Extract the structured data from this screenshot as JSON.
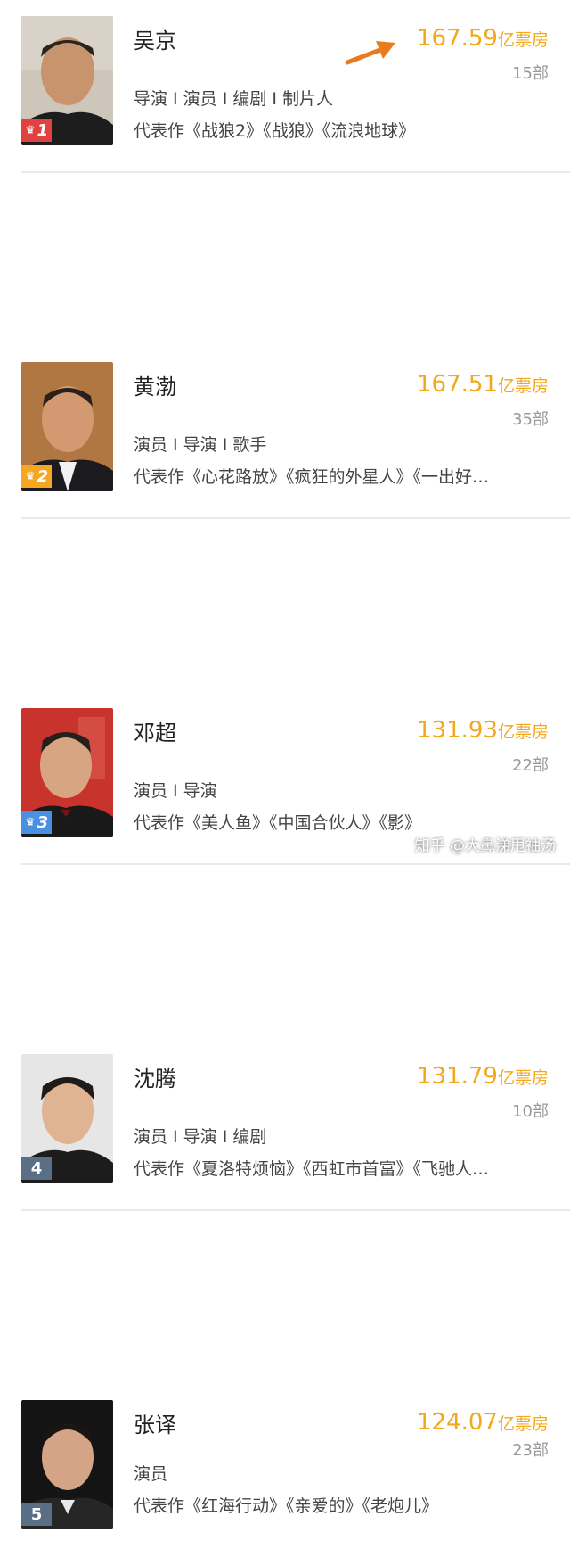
{
  "list": [
    {
      "name": "吴京",
      "roles": "导演 I 演员 I 编剧 I 制片人",
      "works": "代表作《战狼2》《战狼》《流浪地球》",
      "box_office": "167.59",
      "unit": "亿票房",
      "count": "15部",
      "rank": "1",
      "rank_color": "#e34040",
      "crown": true
    },
    {
      "name": "黄渤",
      "roles": "演员 I 导演 I 歌手",
      "works": "代表作《心花路放》《疯狂的外星人》《一出好…",
      "box_office": "167.51",
      "unit": "亿票房",
      "count": "35部",
      "rank": "2",
      "rank_color": "#f5a623",
      "crown": true
    },
    {
      "name": "邓超",
      "roles": "演员 I 导演",
      "works": "代表作《美人鱼》《中国合伙人》《影》",
      "box_office": "131.93",
      "unit": "亿票房",
      "count": "22部",
      "rank": "3",
      "rank_color": "#4a90e2",
      "crown": true
    },
    {
      "name": "沈腾",
      "roles": "演员 I 导演 I 编剧",
      "works": "代表作《夏洛特烦恼》《西虹市首富》《飞驰人…",
      "box_office": "131.79",
      "unit": "亿票房",
      "count": "10部",
      "rank": "4",
      "rank_color": "#5a6e85",
      "crown": false
    },
    {
      "name": "张译",
      "roles": "演员",
      "works": "代表作《红海行动》《亲爱的》《老炮儿》",
      "box_office": "124.07",
      "unit": "亿票房",
      "count": "23部",
      "rank": "5",
      "rank_color": "#5a6e85",
      "crown": false
    }
  ],
  "watermark": "知乎 @大鼻涕甩袖汤",
  "crown_glyph": "♛",
  "colors": {
    "box_office": "#f3a71a",
    "arrow": "#ea7a1e"
  }
}
